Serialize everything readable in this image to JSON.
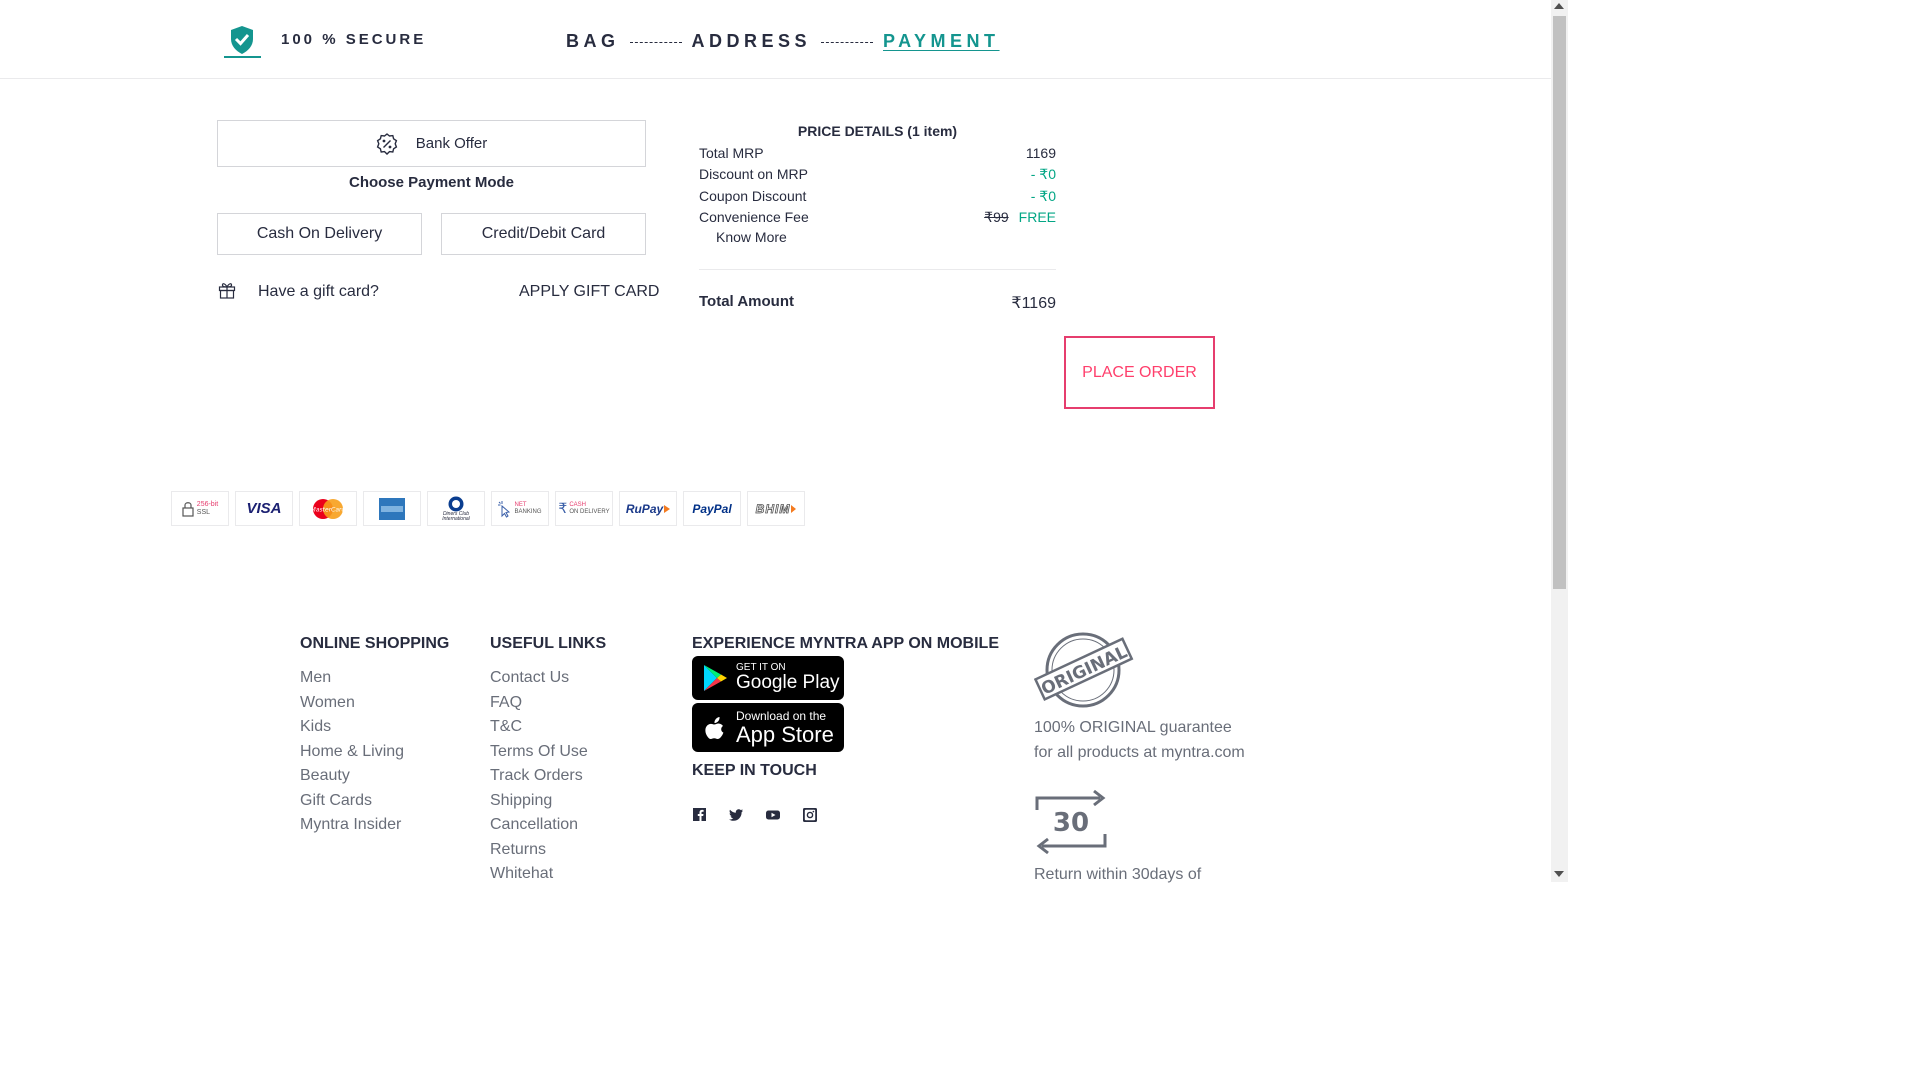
{
  "header": {
    "secure_label": "100 % SECURE",
    "steps": [
      {
        "label": "BAG",
        "active": false
      },
      {
        "label": "ADDRESS",
        "active": false
      },
      {
        "label": "PAYMENT",
        "active": true
      }
    ],
    "accent_color": "#14958f"
  },
  "payment": {
    "bank_offer_label": "Bank Offer",
    "choose_mode_label": "Choose Payment Mode",
    "modes": [
      "Cash On Delivery",
      "Credit/Debit Card"
    ],
    "gift_card_prompt": "Have a gift card?",
    "apply_gift_card_label": "APPLY GIFT CARD"
  },
  "price_details": {
    "title": "PRICE DETAILS (1 item)",
    "rows": [
      {
        "label": "Total MRP",
        "value": "1169"
      },
      {
        "label": "Discount on MRP",
        "value": "- ₹0"
      },
      {
        "label": "Coupon Discount",
        "value": "- ₹0"
      },
      {
        "label": "Convenience Fee",
        "old_value": "₹99",
        "value": "FREE"
      }
    ],
    "know_more_label": "Know More",
    "total_label": "Total Amount",
    "total_value": "₹1169",
    "place_order_label": "PLACE ORDER",
    "place_order_color": "#ff3f6c"
  },
  "payment_logos": {
    "ssl_top": "256-bit",
    "ssl_bottom": "SSL",
    "visa": "VISA",
    "mastercard": "MasterCard",
    "diners_line1": "Diners Club",
    "diners_line2": "International",
    "netbanking_top": "NET",
    "netbanking_bottom": "BANKING",
    "cod_top": "CASH",
    "cod_bottom": "ON DELIVERY",
    "rupay": "RuPay",
    "paypal": "PayPal",
    "bhim": "BHIM"
  },
  "footer": {
    "online_shopping": {
      "heading": "ONLINE SHOPPING",
      "links": [
        "Men",
        "Women",
        "Kids",
        "Home & Living",
        "Beauty",
        "Gift Cards",
        "Myntra Insider"
      ]
    },
    "useful_links": {
      "heading": "USEFUL LINKS",
      "links": [
        "Contact Us",
        "FAQ",
        "T&C",
        "Terms Of Use",
        "Track Orders",
        "Shipping",
        "Cancellation",
        "Returns",
        "Whitehat"
      ]
    },
    "app": {
      "heading": "EXPERIENCE MYNTRA APP ON MOBILE",
      "google_small": "GET IT ON",
      "google_big": "Google Play",
      "apple_small": "Download on the",
      "apple_big": "App Store"
    },
    "keep_in_touch": "KEEP IN TOUCH",
    "original": {
      "badge_text": "ORIGINAL",
      "line1": "100% ORIGINAL guarantee",
      "line2": "for all products at myntra.com"
    },
    "returns": {
      "badge_number": "30",
      "line1": "Return within 30days of"
    }
  }
}
